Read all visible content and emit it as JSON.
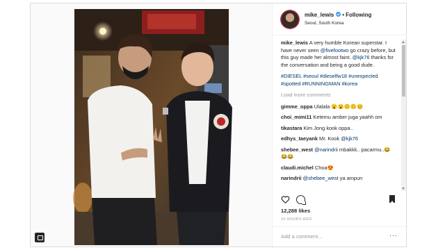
{
  "post": {
    "username": "mike_lewis",
    "follow_label": "Following",
    "location": "Seoul, South Korea",
    "caption": {
      "username": "mike_lewis",
      "text_1": " A very humble Korean superstar. I have never seen ",
      "mention_1": "@fivefootwo",
      "text_2": " go crazy before, but this guy made her almost faint. ",
      "mention_2": "@kjk76",
      "text_3": " thanks for the conversation and being a good dude."
    },
    "hashtags": "#DIESEL #seoul #dieselfw18 #unexpected #spotted #RUNNINGMAN #korea",
    "load_more": "Load more comments",
    "comments": [
      {
        "user": "gimme_oppa",
        "text": " Ulalala 😮😮🙃🙃😊"
      },
      {
        "user": "choi_mimi11",
        "text": " Ketemu amber juga yaahh om"
      },
      {
        "user": "tikastara",
        "text": " Kim Jong kook oppa.."
      },
      {
        "user": "edhys_taeyank",
        "text": " Mr. Kook ",
        "mention": "@kjk76"
      },
      {
        "user": "shebee_west",
        "mention": "@narindrii",
        "text": " mbakkk.. pacarmu..😂😂😂"
      },
      {
        "user": "claudi.michel",
        "text": " Choa😍"
      },
      {
        "user": "narindrii",
        "mention": "@shebee_west",
        "text": " ya ampun"
      }
    ],
    "likes": "12,288 likes",
    "timestamp": "10 HOURS AGO",
    "add_comment_placeholder": "Add a comment...",
    "more_icon": "···"
  },
  "icons": {
    "heart": "heart-icon",
    "comment": "comment-icon",
    "bookmark": "bookmark-icon",
    "verified": "verified-badge-icon",
    "gallery": "gallery-icon"
  },
  "colors": {
    "verified": "#3897f0",
    "link": "#003569",
    "muted": "#999999"
  }
}
